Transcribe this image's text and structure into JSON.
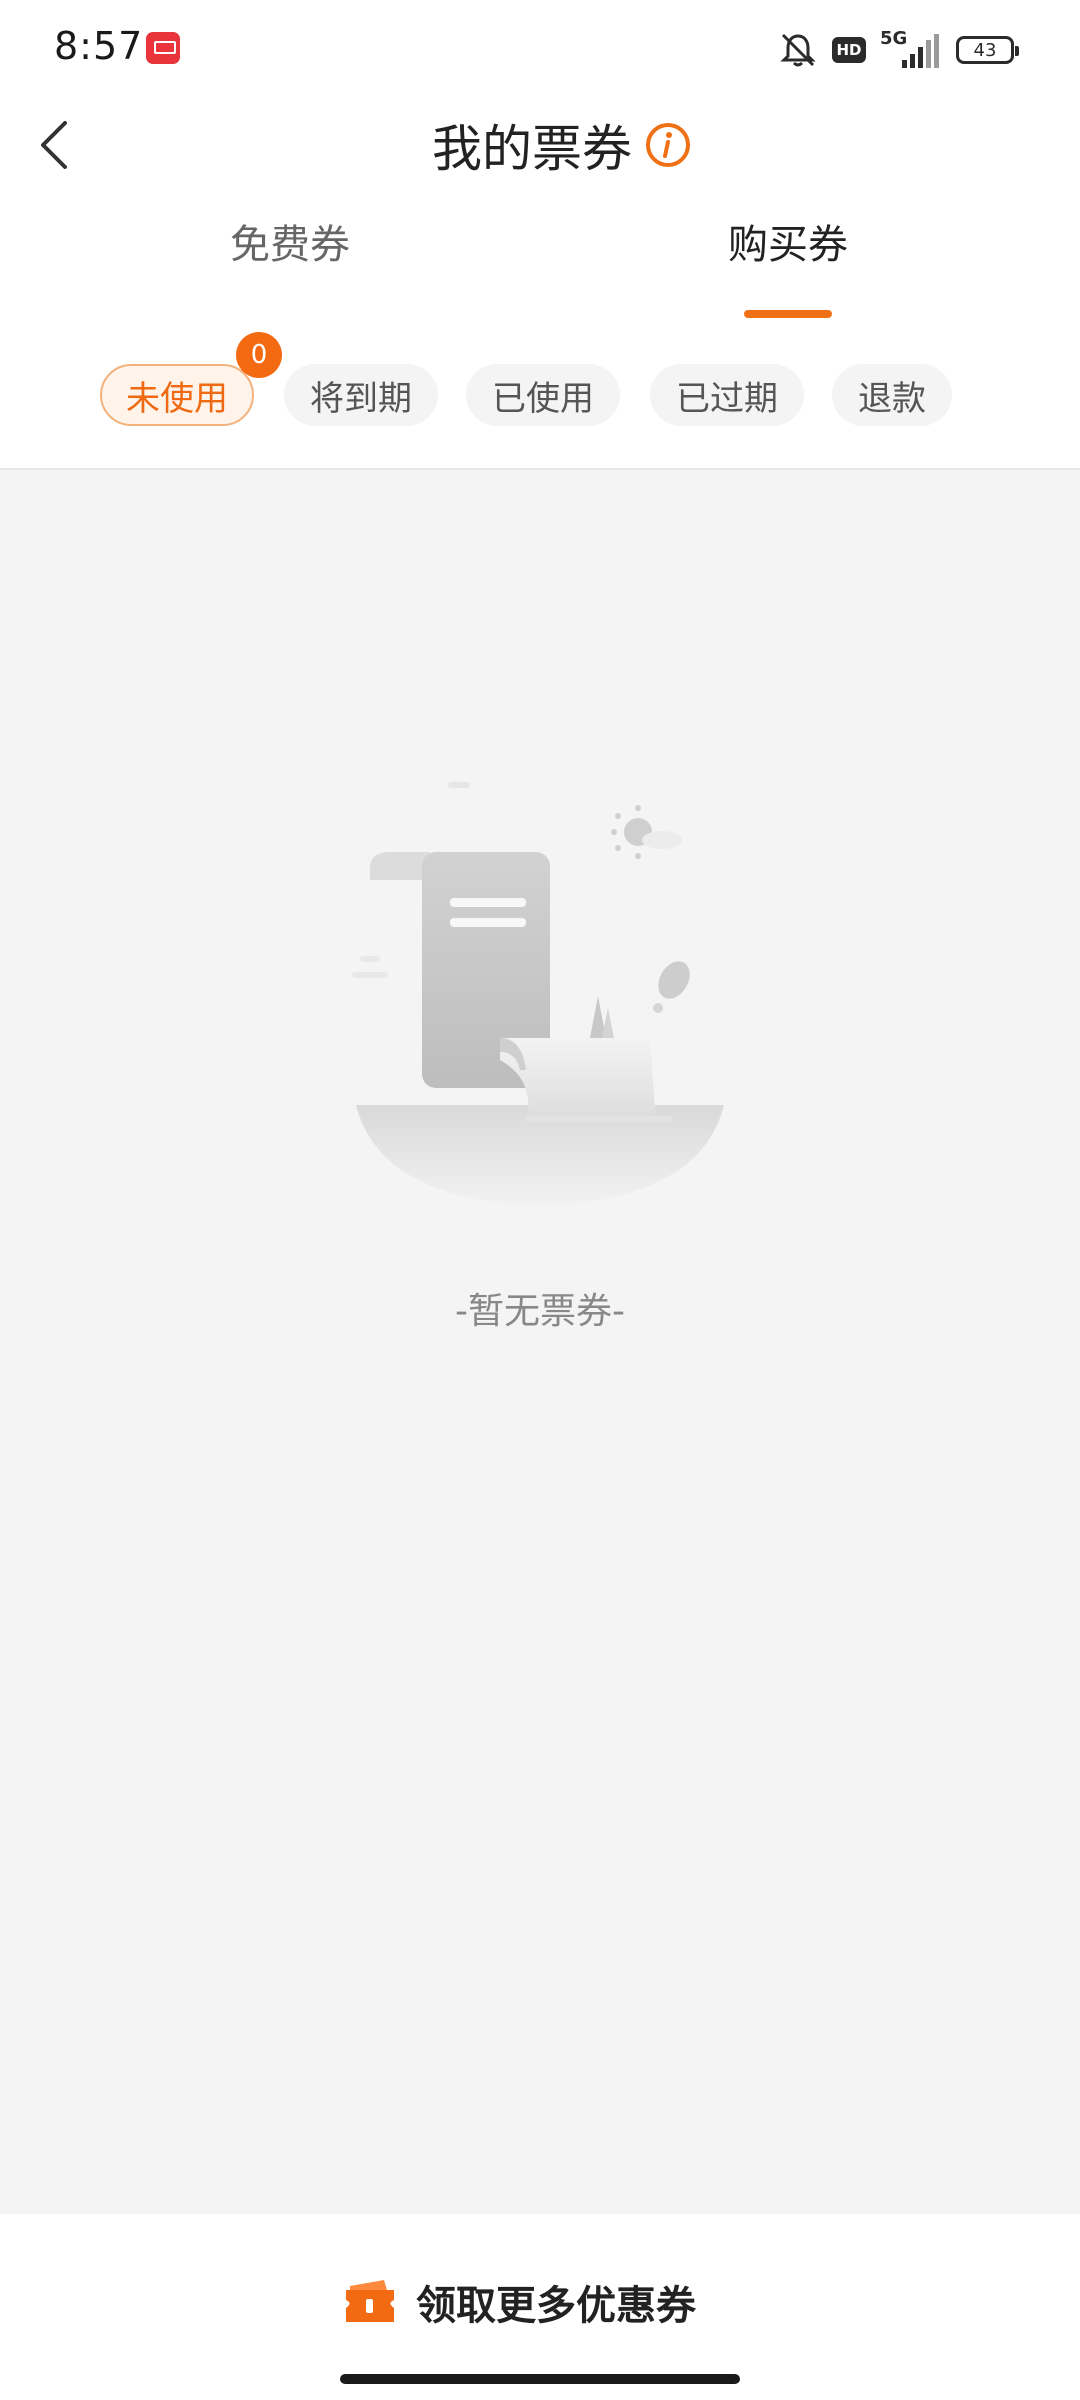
{
  "status_bar": {
    "time": "8:57",
    "network": "5G",
    "hd": "HD",
    "battery": "43"
  },
  "header": {
    "title": "我的票券"
  },
  "main_tabs": [
    {
      "label": "免费券",
      "active": false
    },
    {
      "label": "购买券",
      "active": true
    }
  ],
  "filters": [
    {
      "label": "未使用",
      "active": true,
      "badge": "0"
    },
    {
      "label": "将到期",
      "active": false
    },
    {
      "label": "已使用",
      "active": false
    },
    {
      "label": "已过期",
      "active": false
    },
    {
      "label": "退款",
      "active": false
    }
  ],
  "empty_state": {
    "text": "-暂无票券-"
  },
  "bottom": {
    "button_label": "领取更多优惠券"
  },
  "colors": {
    "accent": "#f07016",
    "background": "#f4f4f4",
    "chip_active_bg": "#fff3ea"
  }
}
